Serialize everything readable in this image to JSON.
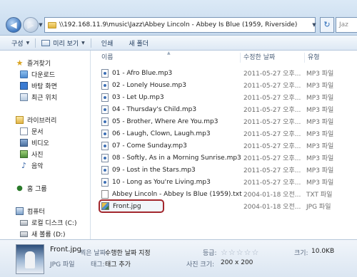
{
  "address": {
    "path": "\\\\192.168.11.9\\music\\Jazz\\Abbey Lincoln - Abbey Is Blue (1959, Riverside)",
    "search_placeholder": "Jaz"
  },
  "toolbar": {
    "organize": "구성",
    "preview": "미리 보기",
    "print": "인쇄",
    "new_folder": "새 폴더"
  },
  "nav": {
    "favorites": "즐겨찾기",
    "downloads": "다운로드",
    "desktop": "바탕 화면",
    "recent": "최근 위치",
    "libraries": "라이브러리",
    "documents": "문서",
    "videos": "비디오",
    "pictures": "사진",
    "music": "음악",
    "homegroup": "홈 그룹",
    "computer": "컴퓨터",
    "local_disk": "로컬 디스크 (C:)",
    "new_volume": "새 볼륨 (D:)"
  },
  "columns": {
    "name": "이름",
    "modified": "수정한 날짜",
    "type": "유형"
  },
  "files": [
    {
      "name": "01 - Afro Blue.mp3",
      "date": "2011-05-27 오후...",
      "type": "MP3 파일",
      "kind": "mp3"
    },
    {
      "name": "02 - Lonely House.mp3",
      "date": "2011-05-27 오후...",
      "type": "MP3 파일",
      "kind": "mp3"
    },
    {
      "name": "03 - Let Up.mp3",
      "date": "2011-05-27 오후...",
      "type": "MP3 파일",
      "kind": "mp3"
    },
    {
      "name": "04 - Thursday's Child.mp3",
      "date": "2011-05-27 오후...",
      "type": "MP3 파일",
      "kind": "mp3"
    },
    {
      "name": "05 - Brother, Where Are You.mp3",
      "date": "2011-05-27 오후...",
      "type": "MP3 파일",
      "kind": "mp3"
    },
    {
      "name": "06 - Laugh, Clown, Laugh.mp3",
      "date": "2011-05-27 오후...",
      "type": "MP3 파일",
      "kind": "mp3"
    },
    {
      "name": "07 - Come Sunday.mp3",
      "date": "2011-05-27 오후...",
      "type": "MP3 파일",
      "kind": "mp3"
    },
    {
      "name": "08 - Softly, As in a Morning Sunrise.mp3",
      "date": "2011-05-27 오후...",
      "type": "MP3 파일",
      "kind": "mp3"
    },
    {
      "name": "09 - Lost in the Stars.mp3",
      "date": "2011-05-27 오후...",
      "type": "MP3 파일",
      "kind": "mp3"
    },
    {
      "name": "10 - Long as You're Living.mp3",
      "date": "2011-05-27 오후...",
      "type": "MP3 파일",
      "kind": "mp3"
    },
    {
      "name": "Abbey Lincoln - Abbey Is Blue (1959).txt",
      "date": "2004-01-18 오전...",
      "type": "TXT 파일",
      "kind": "txt"
    },
    {
      "name": "Front.jpg",
      "date": "2004-01-18 오전...",
      "type": "JPG 파일",
      "kind": "jpg",
      "selected": true
    }
  ],
  "details": {
    "filename": "Front.jpg",
    "filetype": "JPG 파일",
    "date_label": "찍은 날짜:",
    "date_value": "수행한 날짜 지정",
    "tags_label": "태그:",
    "tags_value": "태그 추가",
    "rating_label": "등급:",
    "rating_value": 0,
    "size_label": "사진 크기:",
    "size_value": "200 x 200",
    "filesize_label": "크기:",
    "filesize_value": "10.0KB"
  }
}
